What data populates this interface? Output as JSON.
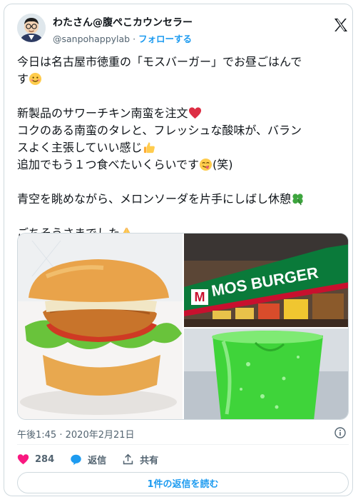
{
  "author": {
    "name": "わたさん@腹ぺこカウンセラー",
    "handle": "@sanpohappylab",
    "separator": "·",
    "follow_label": "フォローする"
  },
  "tweet": {
    "line1": "今日は名古屋市徳重の「モスバーガー」でお昼ごはんで",
    "line2": "す",
    "line3": "新製品のサワーチキン南蛮を注文",
    "line4": "コクのある南蛮のタレと、フレッシュな酸味が、バラン",
    "line5": "スよく主張していい感じ",
    "line6": "追加でもう１つ食べたいくらいです",
    "line6_suffix": "(笑)",
    "line7": "青空を眺めながら、メロンソーダを片手にしばし休憩",
    "line8": "ごちそうさまでした"
  },
  "media": {
    "sign_text": "MOS BURGER",
    "sign_mark": "M"
  },
  "meta": {
    "time": "午後1:45",
    "separator": "·",
    "date": "2020年2月21日"
  },
  "actions": {
    "like_count": "284",
    "reply_label": "返信",
    "share_label": "共有"
  },
  "read_replies_label": "1件の返信を読む",
  "colors": {
    "accent": "#1d9bf0",
    "heart": "#f91880",
    "muted": "#536471",
    "border": "#cfd9de",
    "melon": "#3fd43a",
    "sign_red": "#c8102e",
    "sign_green": "#0a7a3a"
  },
  "icons": [
    "x-logo-icon",
    "info-icon",
    "heart-icon",
    "reply-bubble-icon",
    "share-icon",
    "smile-emoji-icon",
    "red-heart-emoji-icon",
    "thumbs-up-emoji-icon",
    "yum-emoji-icon",
    "four-leaf-clover-emoji-icon",
    "folded-hands-emoji-icon"
  ]
}
